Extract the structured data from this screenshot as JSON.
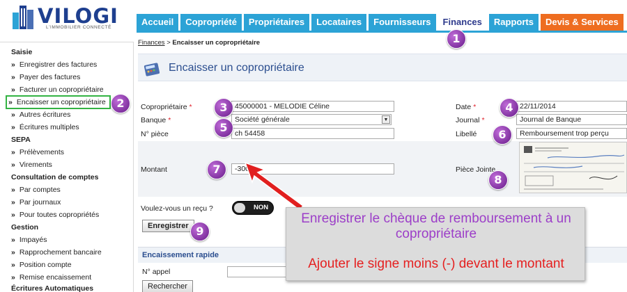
{
  "brand": {
    "name": "VILOGI",
    "tagline": "L'IMMOBILIER CONNECTÉ"
  },
  "nav": {
    "tabs": [
      {
        "label": "Accueil"
      },
      {
        "label": "Copropriété"
      },
      {
        "label": "Propriétaires"
      },
      {
        "label": "Locataires"
      },
      {
        "label": "Fournisseurs"
      },
      {
        "label": "Finances"
      },
      {
        "label": "Rapports"
      },
      {
        "label": "Devis & Services"
      }
    ],
    "active_tab": "Finances"
  },
  "sidebar": {
    "sections": [
      {
        "title": "Saisie",
        "items": [
          "Enregistrer des factures",
          "Payer des factures",
          "Facturer un copropriétaire",
          "Encaisser un copropriétaire",
          "Autres écritures",
          "Écritures multiples"
        ]
      },
      {
        "title": "SEPA",
        "items": [
          "Prélèvements",
          "Virements"
        ]
      },
      {
        "title": "Consultation de comptes",
        "items": [
          "Par comptes",
          "Par journaux",
          "Pour toutes copropriétés"
        ]
      },
      {
        "title": "Gestion",
        "items": [
          "Impayés",
          "Rapprochement bancaire",
          "Position compte",
          "Remise encaissement"
        ]
      },
      {
        "title": "Écritures Automatiques",
        "items": []
      }
    ],
    "bullet": "»",
    "current_item": "Encaisser un copropriétaire"
  },
  "breadcrumb": {
    "parent": "Finances",
    "separator": " > ",
    "current": "Encaisser un copropriétaire"
  },
  "page": {
    "title": "Encaisser un copropriétaire"
  },
  "form": {
    "coproprietaire": {
      "label": "Copropriétaire",
      "required": "*",
      "value": "45000001 - MELODIE Céline"
    },
    "banque": {
      "label": "Banque",
      "required": "*",
      "value": "Société générale"
    },
    "n_piece": {
      "label": "N° pièce",
      "value": "ch 54458"
    },
    "montant": {
      "label": "Montant",
      "value": "-300"
    },
    "date": {
      "label": "Date",
      "required": "*",
      "value": "22/11/2014"
    },
    "journal": {
      "label": "Journal",
      "required": "*",
      "value": "Journal de Banque"
    },
    "libelle": {
      "label": "Libellé",
      "value": "Remboursement trop perçu"
    },
    "piece_jointe": {
      "label": "Pièce Jointe"
    },
    "recu": {
      "label": "Voulez-vous un reçu ?",
      "toggle_text": "NON"
    },
    "submit_label": "Enregistrer"
  },
  "quick": {
    "title": "Encaissement rapide",
    "appel_label": "N° appel",
    "search_label": "Rechercher"
  },
  "callouts": [
    "1",
    "2",
    "3",
    "4",
    "5",
    "6",
    "7",
    "8",
    "9"
  ],
  "annotation": {
    "line1": "Enregistrer le chèque de remboursement à un copropriétaire",
    "line2": "Ajouter le signe moins (-) devant le montant"
  },
  "colors": {
    "tab_blue": "#2ca3d6",
    "tab_orange": "#ee6d20",
    "title_blue": "#2b4e8f",
    "callout_purple": "#8e3db0",
    "highlight_green": "#33b343",
    "required_red": "#e0202a"
  }
}
